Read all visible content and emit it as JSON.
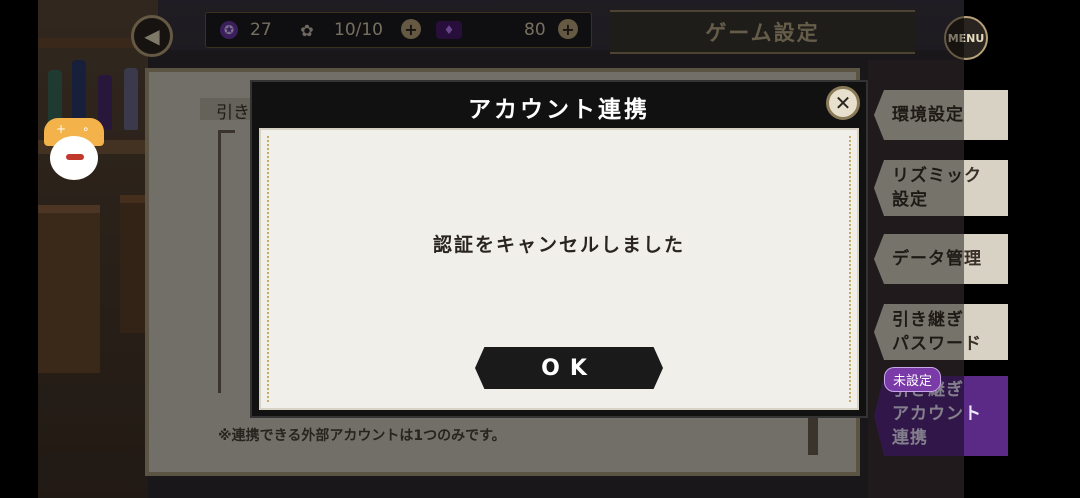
{
  "top_bar": {
    "back_icon": "back-arrow-icon",
    "gem_count": "27",
    "stamina": "10/10",
    "ticket_count": "80",
    "title": "ゲーム設定",
    "menu_label": "MENU"
  },
  "side_tabs": [
    {
      "label": "環境設定"
    },
    {
      "label": "リズミック\n設定"
    },
    {
      "label": "データ管理"
    },
    {
      "label": "引き継ぎ\nパスワード"
    },
    {
      "label": "引き継ぎ\nアカウント\n連携"
    }
  ],
  "unset_badge": "未設定",
  "background_panel": {
    "label": "引き",
    "note": "※連携できる外部アカウントは1つのみです。"
  },
  "dialog": {
    "title": "アカウント連携",
    "message": "認証をキャンセルしました",
    "ok_label": "OK"
  },
  "colors": {
    "accent_purple": "#5a2a86",
    "gold": "#b8a27a",
    "dialog_bg": "#111111"
  }
}
